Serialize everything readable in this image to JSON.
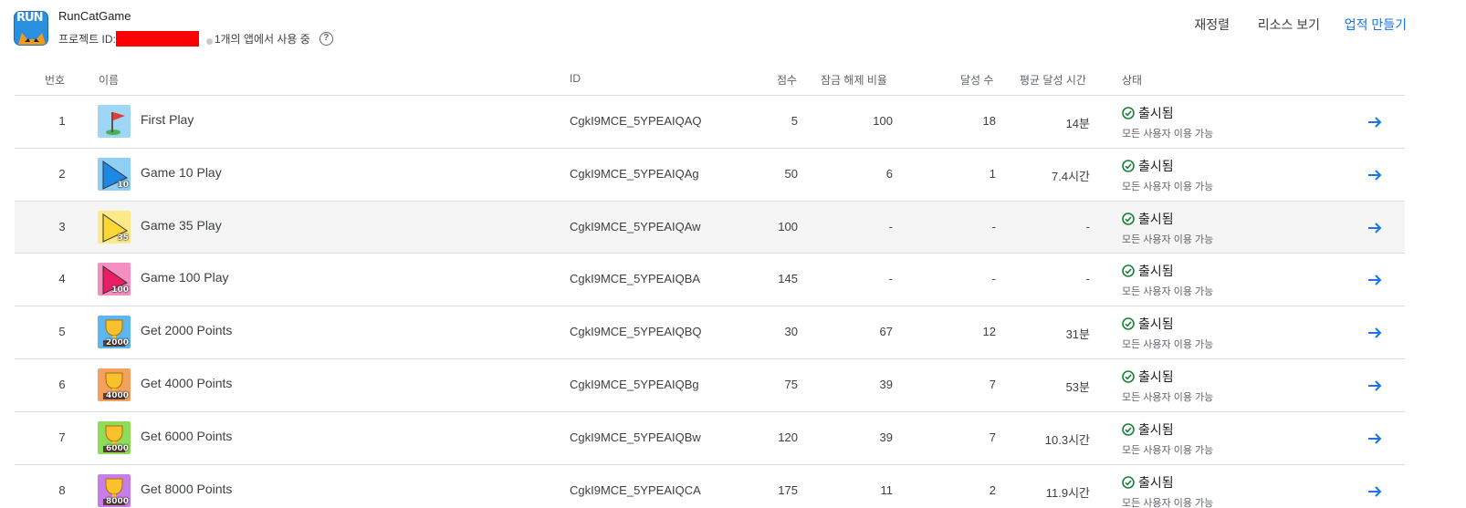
{
  "app": {
    "icon": "runcat-app-icon",
    "icon_text": "RUN",
    "title": "RunCatGame",
    "project_label": "프로젝트 ID:",
    "usage_text": "1개의 앱에서 사용 중",
    "help_icon": "help-circle-icon"
  },
  "actions": {
    "reorder": "재정렬",
    "resources": "리소스 보기",
    "create": "업적 만들기"
  },
  "colors": {
    "accent": "#1a73e8",
    "success": "#188038",
    "redaction": "#ff0000"
  },
  "table": {
    "headers": {
      "num": "번호",
      "name": "이름",
      "id": "ID",
      "score": "점수",
      "unlock": "잠금 해제 비율",
      "count": "달성 수",
      "time": "평균 달성 시간",
      "status": "상태"
    },
    "rows": [
      {
        "num": "1",
        "name": "First Play",
        "id": "CgkI9MCE_5YPEAIQAQ",
        "score": "5",
        "unlock": "100",
        "count": "18",
        "time": "14분",
        "status": "출시됨",
        "availability": "모든 사용자 이용 가능",
        "icon": "red-flag-icon",
        "icon_bg": "#9fd6f5",
        "badge": ""
      },
      {
        "num": "2",
        "name": "Game 10 Play",
        "id": "CgkI9MCE_5YPEAIQAg",
        "score": "50",
        "unlock": "6",
        "count": "1",
        "time": "7.4시간",
        "status": "출시됨",
        "availability": "모든 사용자 이용 가능",
        "icon": "blue-pennant-icon",
        "icon_bg": "#8ecff5",
        "badge": "10"
      },
      {
        "num": "3",
        "name": "Game 35 Play",
        "id": "CgkI9MCE_5YPEAIQAw",
        "score": "100",
        "unlock": "-",
        "count": "-",
        "time": "-",
        "status": "출시됨",
        "availability": "모든 사용자 이용 가능",
        "icon": "yellow-pennant-icon",
        "icon_bg": "#fde98a",
        "badge": "35"
      },
      {
        "num": "4",
        "name": "Game 100 Play",
        "id": "CgkI9MCE_5YPEAIQBA",
        "score": "145",
        "unlock": "-",
        "count": "-",
        "time": "-",
        "status": "출시됨",
        "availability": "모든 사용자 이용 가능",
        "icon": "pink-pennant-icon",
        "icon_bg": "#f48fc0",
        "badge": "100"
      },
      {
        "num": "5",
        "name": "Get 2000 Points",
        "id": "CgkI9MCE_5YPEAIQBQ",
        "score": "30",
        "unlock": "67",
        "count": "12",
        "time": "31분",
        "status": "출시됨",
        "availability": "모든 사용자 이용 가능",
        "icon": "trophy-2000-icon",
        "icon_bg": "#5eb6f0",
        "badge": "2000"
      },
      {
        "num": "6",
        "name": "Get 4000 Points",
        "id": "CgkI9MCE_5YPEAIQBg",
        "score": "75",
        "unlock": "39",
        "count": "7",
        "time": "53분",
        "status": "출시됨",
        "availability": "모든 사용자 이용 가능",
        "icon": "trophy-4000-icon",
        "icon_bg": "#f4a160",
        "badge": "4000"
      },
      {
        "num": "7",
        "name": "Get 6000 Points",
        "id": "CgkI9MCE_5YPEAIQBw",
        "score": "120",
        "unlock": "39",
        "count": "7",
        "time": "10.3시간",
        "status": "출시됨",
        "availability": "모든 사용자 이용 가능",
        "icon": "trophy-6000-icon",
        "icon_bg": "#8fdc5a",
        "badge": "6000"
      },
      {
        "num": "8",
        "name": "Get 8000 Points",
        "id": "CgkI9MCE_5YPEAIQCA",
        "score": "175",
        "unlock": "11",
        "count": "2",
        "time": "11.9시간",
        "status": "출시됨",
        "availability": "모든 사용자 이용 가능",
        "icon": "trophy-8000-icon",
        "icon_bg": "#c77ee8",
        "badge": "8000"
      }
    ]
  }
}
